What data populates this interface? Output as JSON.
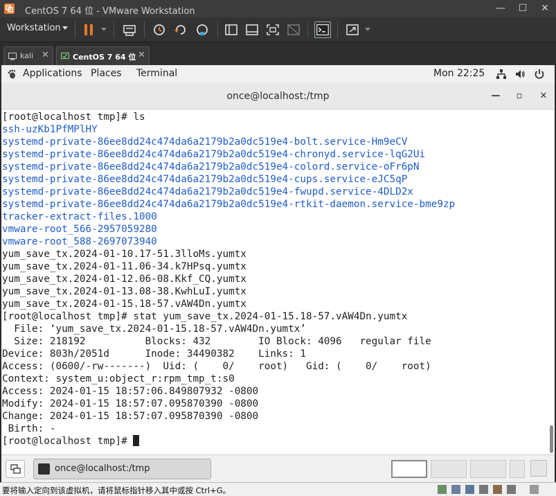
{
  "window": {
    "title": "CentOS 7 64 位 - VMware Workstation",
    "minimize": "—",
    "maximize": "☐",
    "close": "✕"
  },
  "toolbar": {
    "menu_label": "Workstation"
  },
  "tabs": [
    {
      "label": "kali",
      "close": "✕"
    },
    {
      "label": "CentOS 7 64 位",
      "close": "✕"
    }
  ],
  "gnome_top": {
    "applications": "Applications",
    "places": "Places",
    "terminal": "Terminal",
    "clock": "Mon 22:25"
  },
  "terminal": {
    "title": "once@localhost:/tmp",
    "minimize": "—",
    "maximize": "▫",
    "close": "✕",
    "prompt_last": "[root@localhost tmp]# ",
    "lines": [
      {
        "text": "[root@localhost tmp]# ls",
        "type": "plain"
      },
      {
        "text": "ssh-uzKb1PfMPlHY",
        "type": "dir"
      },
      {
        "text": "systemd-private-86ee8dd24c474da6a2179b2a0dc519e4-bolt.service-Hm9eCV",
        "type": "dir"
      },
      {
        "text": "systemd-private-86ee8dd24c474da6a2179b2a0dc519e4-chronyd.service-lqG2Ui",
        "type": "dir"
      },
      {
        "text": "systemd-private-86ee8dd24c474da6a2179b2a0dc519e4-colord.service-oFr6pN",
        "type": "dir"
      },
      {
        "text": "systemd-private-86ee8dd24c474da6a2179b2a0dc519e4-cups.service-eJC5qP",
        "type": "dir"
      },
      {
        "text": "systemd-private-86ee8dd24c474da6a2179b2a0dc519e4-fwupd.service-4DLD2x",
        "type": "dir"
      },
      {
        "text": "systemd-private-86ee8dd24c474da6a2179b2a0dc519e4-rtkit-daemon.service-bme9zp",
        "type": "dir"
      },
      {
        "text": "tracker-extract-files.1000",
        "type": "dir"
      },
      {
        "text": "vmware-root_566-2957059280",
        "type": "dir"
      },
      {
        "text": "vmware-root_588-2697073940",
        "type": "dir"
      },
      {
        "text": "yum_save_tx.2024-01-10.17-51.3lloMs.yumtx",
        "type": "plain"
      },
      {
        "text": "yum_save_tx.2024-01-11.06-34.k7HPsq.yumtx",
        "type": "plain"
      },
      {
        "text": "yum_save_tx.2024-01-12.06-08.Kkf_CQ.yumtx",
        "type": "plain"
      },
      {
        "text": "yum_save_tx.2024-01-13.08-38.KwhLuI.yumtx",
        "type": "plain"
      },
      {
        "text": "yum_save_tx.2024-01-15.18-57.vAW4Dn.yumtx",
        "type": "plain"
      },
      {
        "text": "[root@localhost tmp]# stat yum_save_tx.2024-01-15.18-57.vAW4Dn.yumtx",
        "type": "plain"
      },
      {
        "text": "  File: ‘yum_save_tx.2024-01-15.18-57.vAW4Dn.yumtx’",
        "type": "plain"
      },
      {
        "text": "  Size: 218192          Blocks: 432        IO Block: 4096   regular file",
        "type": "plain"
      },
      {
        "text": "Device: 803h/2051d      Inode: 34490382    Links: 1",
        "type": "plain"
      },
      {
        "text": "Access: (0600/-rw-------)  Uid: (    0/    root)   Gid: (    0/    root)",
        "type": "plain"
      },
      {
        "text": "Context: system_u:object_r:rpm_tmp_t:s0",
        "type": "plain"
      },
      {
        "text": "Access: 2024-01-15 18:57:06.849807932 -0800",
        "type": "plain"
      },
      {
        "text": "Modify: 2024-01-15 18:57:07.095870390 -0800",
        "type": "plain"
      },
      {
        "text": "Change: 2024-01-15 18:57:07.095870390 -0800",
        "type": "plain"
      },
      {
        "text": " Birth: -",
        "type": "plain"
      }
    ]
  },
  "taskbar": {
    "task_label": "once@localhost:/tmp"
  },
  "status_bar": {
    "text": "要将输入定向到该虚拟机，请将鼠标指针移入其中或按 Ctrl+G。"
  },
  "colors": {
    "directory": "#1f5cc8",
    "vmware_chrome": "#333333",
    "gnome_bar": "#f0f0f0",
    "pause_accent": "#e8792a"
  }
}
